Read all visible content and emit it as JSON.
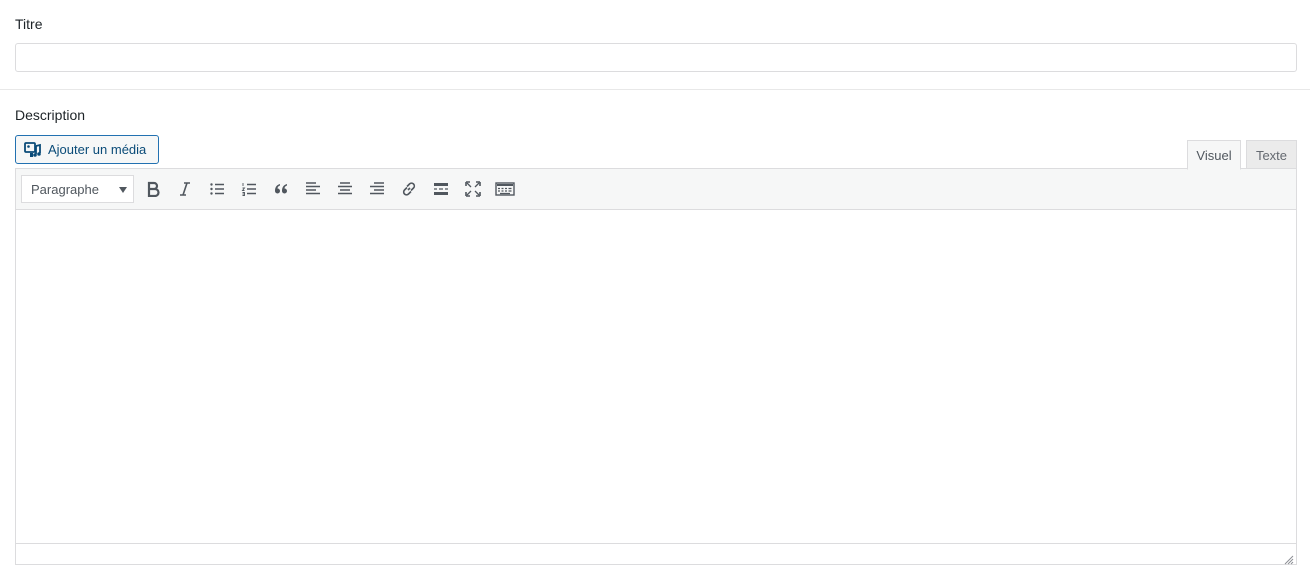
{
  "title_field": {
    "label": "Titre",
    "value": "",
    "placeholder": ""
  },
  "description_field": {
    "label": "Description"
  },
  "media_button": {
    "label": "Ajouter un média",
    "icon": "add-media-icon"
  },
  "editor_tabs": [
    {
      "label": "Visuel",
      "active": true
    },
    {
      "label": "Texte",
      "active": false
    }
  ],
  "toolbar": {
    "format_select": {
      "selected": "Paragraphe"
    },
    "buttons": [
      "bold-icon",
      "italic-icon",
      "bullet-list-icon",
      "numbered-list-icon",
      "blockquote-icon",
      "align-left-icon",
      "align-center-icon",
      "align-right-icon",
      "link-icon",
      "read-more-icon",
      "fullscreen-icon",
      "toolbar-toggle-icon"
    ]
  },
  "editor": {
    "content": ""
  },
  "colors": {
    "accent": "#2271b1",
    "accent_text": "#0a4b78",
    "border": "#dcdcde",
    "toolbar_bg": "#f6f7f7"
  }
}
